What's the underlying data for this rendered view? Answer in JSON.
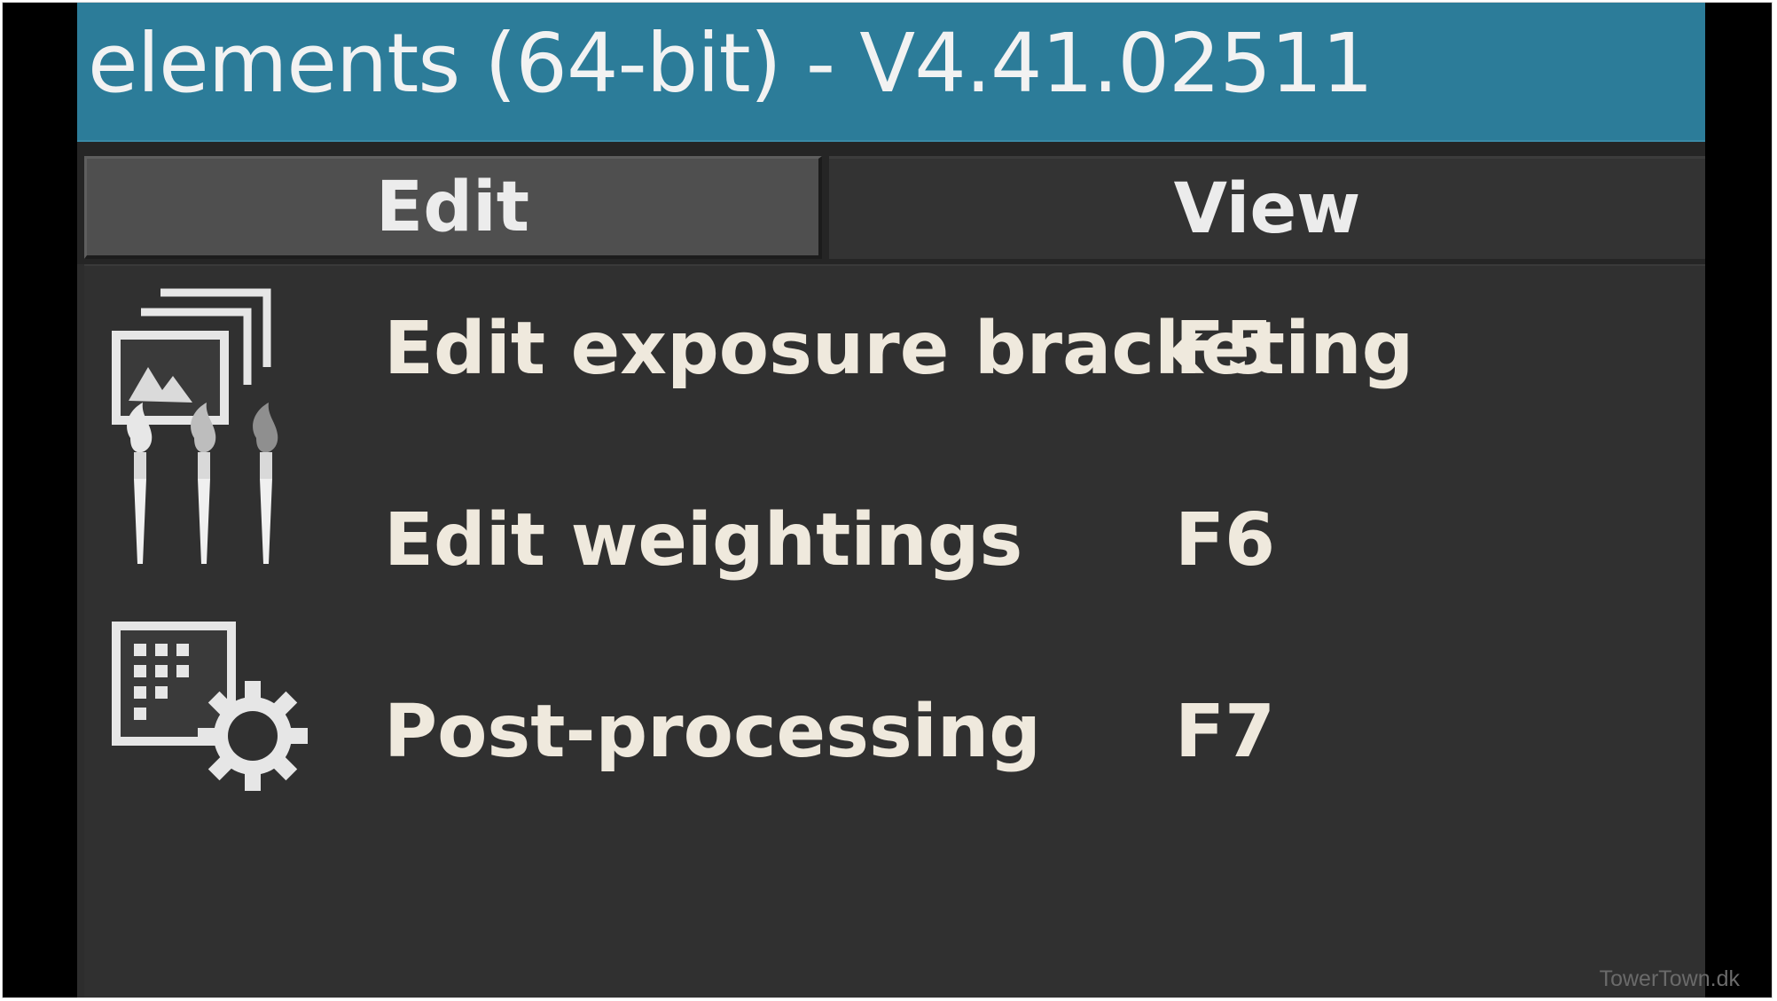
{
  "window": {
    "title": "elements (64-bit) - V4.41.02511"
  },
  "tabs": [
    {
      "label": "Edit",
      "active": true
    },
    {
      "label": "View",
      "active": false
    }
  ],
  "menu": {
    "items": [
      {
        "label": "Edit exposure bracketing",
        "shortcut": "F5",
        "icon": "image-stack-icon"
      },
      {
        "label": "Edit weightings",
        "shortcut": "F6",
        "icon": "paintbrushes-icon"
      },
      {
        "label": "Post-processing",
        "shortcut": "F7",
        "icon": "grid-gear-icon"
      }
    ]
  },
  "watermark": "TowerTown.dk",
  "colors": {
    "titlebar": "#2c7c99",
    "panel": "#303030",
    "text": "#efe9dd"
  }
}
